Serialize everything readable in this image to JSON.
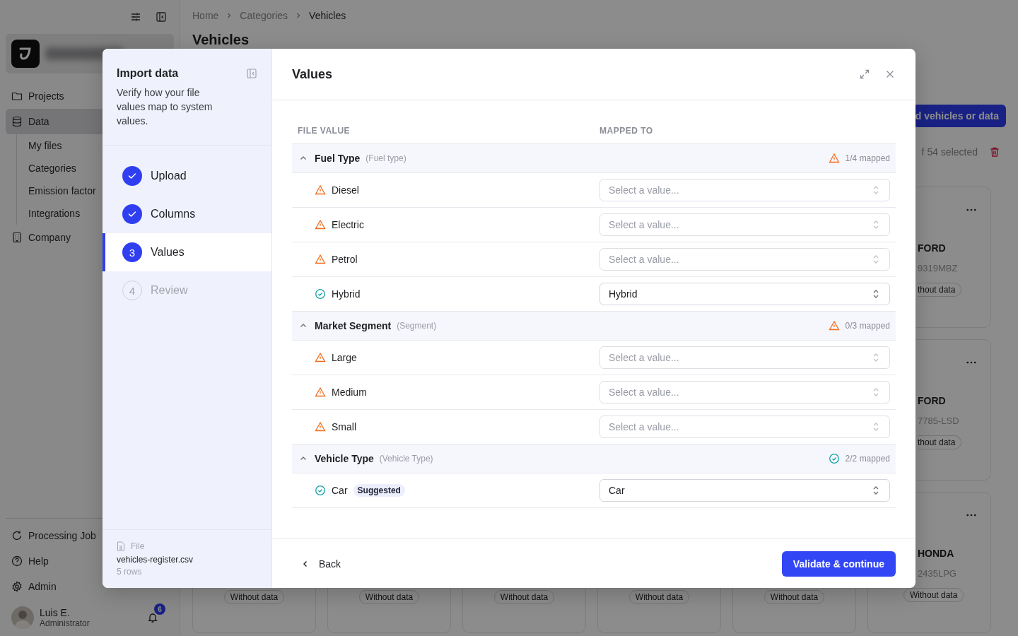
{
  "sidebar": {
    "items": [
      {
        "label": "Projects",
        "selected": false
      },
      {
        "label": "Data",
        "selected": true,
        "children": [
          {
            "label": "My files"
          },
          {
            "label": "Categories"
          },
          {
            "label": "Emission factor"
          },
          {
            "label": "Integrations"
          }
        ]
      },
      {
        "label": "Company",
        "selected": false
      }
    ],
    "bottom_items": [
      {
        "label": "Processing Job"
      },
      {
        "label": "Help"
      },
      {
        "label": "Admin"
      }
    ],
    "user": {
      "name": "Luis E.",
      "role": "Administrator",
      "notifications": "6"
    }
  },
  "breadcrumb": [
    "Home",
    "Categories",
    "Vehicles"
  ],
  "page_title": "Vehicles",
  "add_button": "d vehicles or data",
  "selection_text": "f 54 selected",
  "cards": [
    {
      "make": "FORD",
      "plate": "9319MBZ",
      "status": "thout data",
      "cut": true
    },
    {
      "make": "FORD",
      "plate": "7785-LSD",
      "status": "thout data",
      "cut": true
    },
    {
      "make": "HONDA",
      "plate": "2435LPG",
      "status": "Without data",
      "cut": false
    }
  ],
  "bottom_row_badges": [
    "Without data",
    "Without data",
    "Without data",
    "Without data",
    "Without data"
  ],
  "modal": {
    "title": "Import data",
    "description": "Verify how your file values map to system values.",
    "steps": [
      {
        "label": "Upload",
        "completed": true,
        "selected": false
      },
      {
        "label": "Columns",
        "completed": true,
        "selected": false
      },
      {
        "label": "Values",
        "completed": false,
        "number": "3",
        "selected": true
      },
      {
        "label": "Review",
        "completed": false,
        "number": "4",
        "selected": false
      }
    ],
    "file": {
      "label": "File",
      "name": "vehicles-register.csv",
      "rows": "5 rows"
    },
    "panel_title": "Values",
    "columns": [
      "FILE VALUE",
      "MAPPED TO"
    ],
    "groups": [
      {
        "name": "Fuel Type",
        "source": "(Fuel type)",
        "complete": false,
        "summary": "1/4 mapped",
        "expanded": true,
        "values": [
          {
            "label": "Diesel",
            "mapped": false,
            "placeholder": "Select a value..."
          },
          {
            "label": "Electric",
            "mapped": false,
            "placeholder": "Select a value..."
          },
          {
            "label": "Petrol",
            "mapped": false,
            "placeholder": "Select a value..."
          },
          {
            "label": "Hybrid",
            "mapped": true,
            "value": "Hybrid"
          }
        ]
      },
      {
        "name": "Market Segment",
        "source": "(Segment)",
        "complete": false,
        "summary": "0/3 mapped",
        "expanded": true,
        "values": [
          {
            "label": "Large",
            "mapped": false,
            "placeholder": "Select a value..."
          },
          {
            "label": "Medium",
            "mapped": false,
            "placeholder": "Select a value..."
          },
          {
            "label": "Small",
            "mapped": false,
            "placeholder": "Select a value..."
          }
        ]
      },
      {
        "name": "Vehicle Type",
        "source": "(Vehicle Type)",
        "complete": true,
        "summary": "2/2 mapped",
        "expanded": true,
        "values": [
          {
            "label": "Car",
            "mapped": true,
            "badge": "Suggested",
            "value": "Car"
          }
        ]
      }
    ],
    "back": "Back",
    "primary": "Validate & continue"
  }
}
